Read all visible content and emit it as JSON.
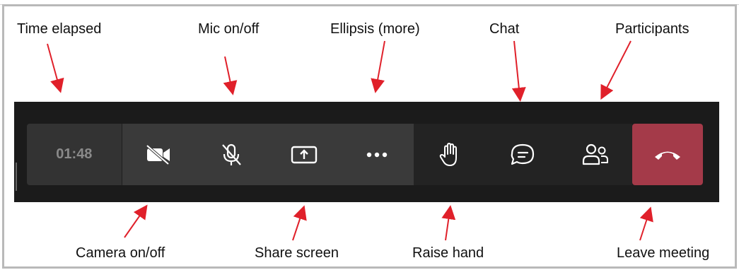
{
  "annotations": {
    "time_elapsed": "Time elapsed",
    "mic": "Mic on/off",
    "ellipsis": "Ellipsis (more)",
    "chat": "Chat",
    "participants": "Participants",
    "camera": "Camera on/off",
    "share": "Share screen",
    "raise_hand": "Raise hand",
    "leave": "Leave meeting"
  },
  "toolbar": {
    "timer": "01:48",
    "buttons": [
      "camera",
      "microphone",
      "share-screen",
      "more",
      "raise-hand",
      "chat",
      "participants",
      "leave"
    ]
  },
  "colors": {
    "toolbar_bg": "#1b1b1b",
    "group_dark": "#3a3a3a",
    "leave": "#a43a49",
    "arrow": "#e0202a"
  }
}
